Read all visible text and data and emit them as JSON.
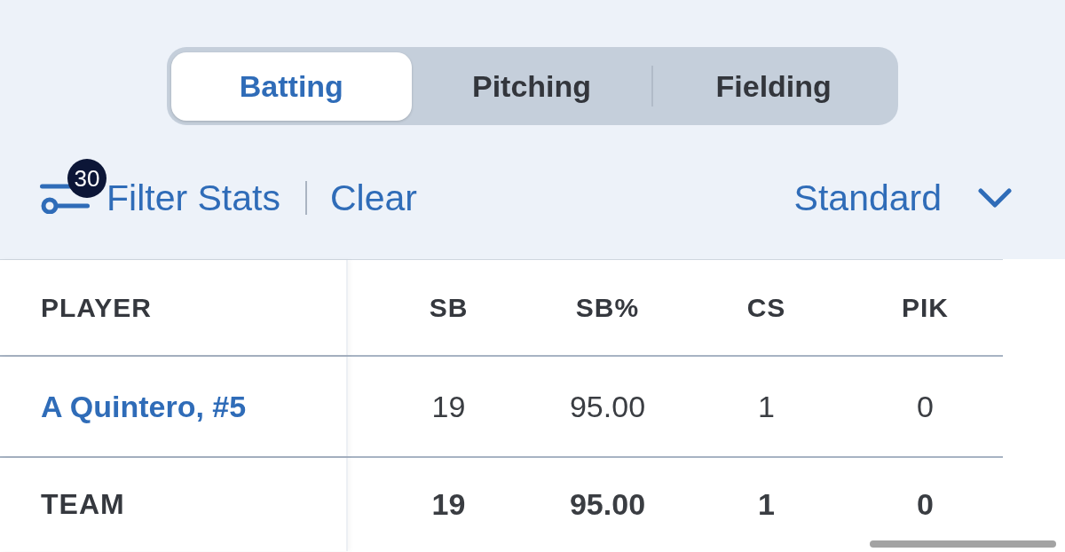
{
  "tabs": [
    {
      "label": "Batting",
      "selected": true
    },
    {
      "label": "Pitching",
      "selected": false
    },
    {
      "label": "Fielding",
      "selected": false
    }
  ],
  "filter": {
    "count": "30",
    "label": "Filter Stats",
    "clear": "Clear"
  },
  "view_select": {
    "value": "Standard"
  },
  "table": {
    "columns": [
      "PLAYER",
      "SB",
      "SB%",
      "CS",
      "PIK"
    ],
    "rows": [
      {
        "kind": "player",
        "cells": [
          "A Quintero, #5",
          "19",
          "95.00",
          "1",
          "0"
        ]
      },
      {
        "kind": "total",
        "cells": [
          "TEAM",
          "19",
          "95.00",
          "1",
          "0"
        ]
      }
    ]
  }
}
